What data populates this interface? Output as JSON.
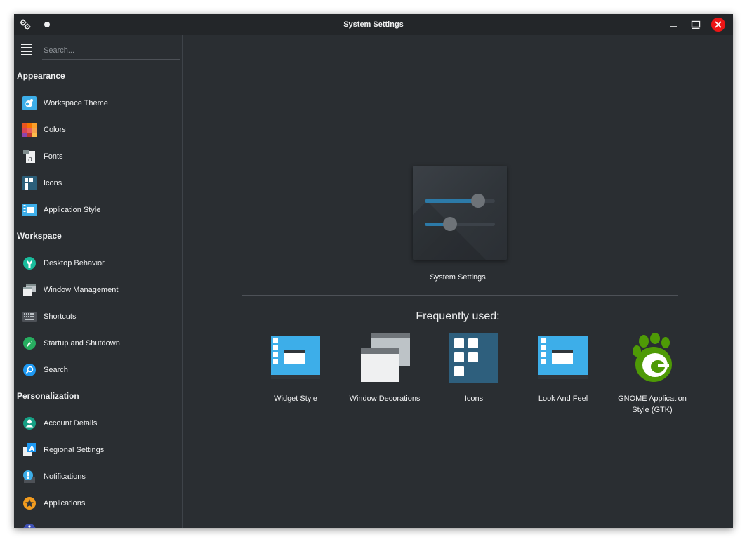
{
  "window": {
    "title": "System Settings"
  },
  "search": {
    "placeholder": "Search..."
  },
  "sidebar": {
    "sections": [
      {
        "title": "Appearance",
        "items": [
          {
            "label": "Workspace Theme",
            "icon": "workspace-theme-icon"
          },
          {
            "label": "Colors",
            "icon": "colors-icon"
          },
          {
            "label": "Fonts",
            "icon": "fonts-icon"
          },
          {
            "label": "Icons",
            "icon": "icons-icon"
          },
          {
            "label": "Application Style",
            "icon": "application-style-icon"
          }
        ]
      },
      {
        "title": "Workspace",
        "items": [
          {
            "label": "Desktop Behavior",
            "icon": "desktop-behavior-icon"
          },
          {
            "label": "Window Management",
            "icon": "window-management-icon"
          },
          {
            "label": "Shortcuts",
            "icon": "keyboard-icon"
          },
          {
            "label": "Startup and Shutdown",
            "icon": "rocket-icon"
          },
          {
            "label": "Search",
            "icon": "search-icon"
          }
        ]
      },
      {
        "title": "Personalization",
        "items": [
          {
            "label": "Account Details",
            "icon": "user-icon"
          },
          {
            "label": "Regional Settings",
            "icon": "regional-settings-icon"
          },
          {
            "label": "Notifications",
            "icon": "notification-icon"
          },
          {
            "label": "Applications",
            "icon": "star-icon"
          }
        ]
      }
    ]
  },
  "main": {
    "hero_label": "System Settings",
    "frequently_used_title": "Frequently used:",
    "frequently_used": [
      {
        "label": "Widget Style",
        "icon": "widget-style-icon"
      },
      {
        "label": "Window Decorations",
        "icon": "window-decorations-icon"
      },
      {
        "label": "Icons",
        "icon": "icons-icon"
      },
      {
        "label": "Look And Feel",
        "icon": "look-and-feel-icon"
      },
      {
        "label": "GNOME Application Style (GTK)",
        "icon": "gnome-foot-icon"
      }
    ]
  },
  "colors": {
    "background": "#2a2e32",
    "titlebar": "#232629",
    "text": "#eff0f1",
    "accent": "#3daee9",
    "close": "#ed1515"
  }
}
